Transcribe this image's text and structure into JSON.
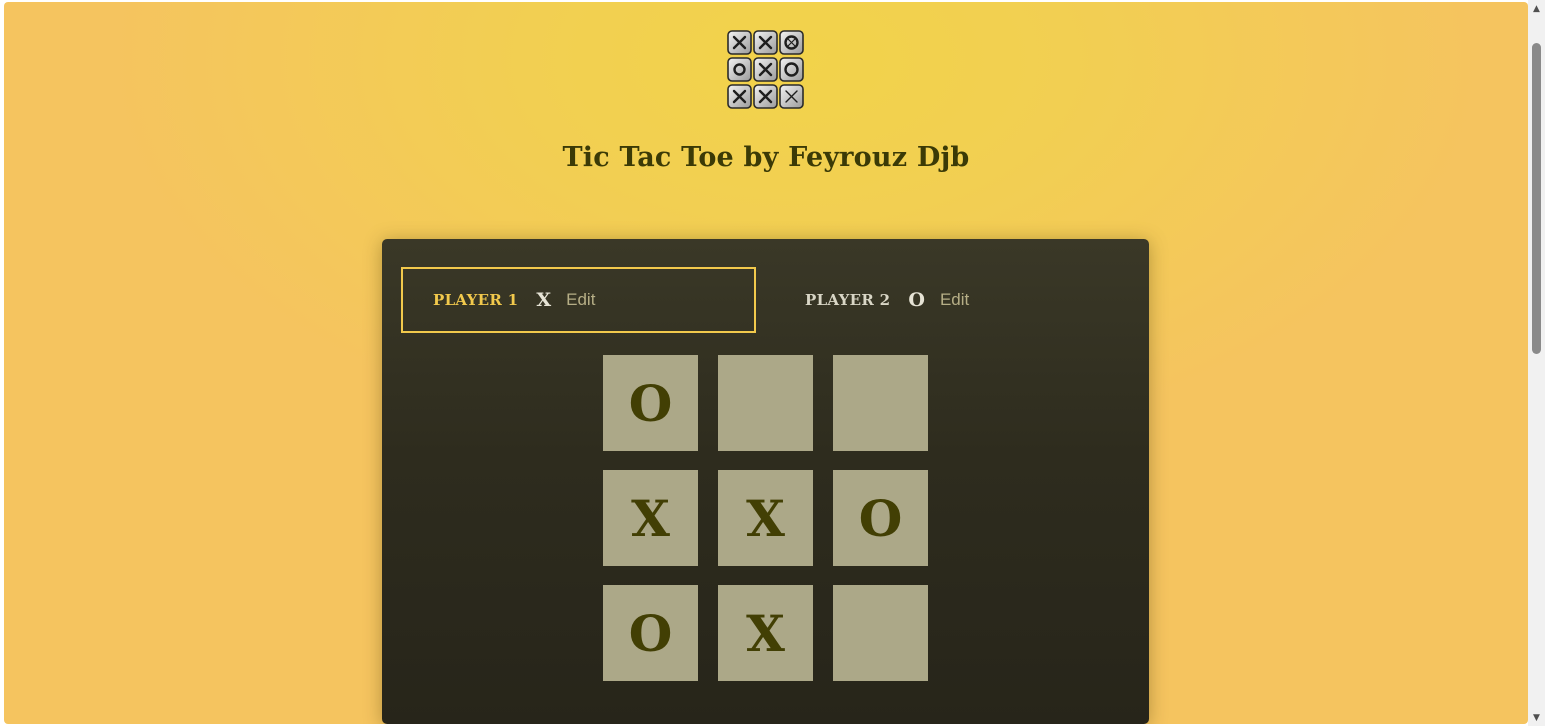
{
  "header": {
    "title": "Tic Tac Toe by Feyrouz Djb",
    "logo_icon": "tic-tac-toe-logo-icon"
  },
  "players": [
    {
      "name": "PLAYER 1",
      "symbol": "X",
      "edit_label": "Edit",
      "active": true
    },
    {
      "name": "PLAYER 2",
      "symbol": "O",
      "edit_label": "Edit",
      "active": false
    }
  ],
  "board": {
    "rows": [
      [
        "O",
        "",
        ""
      ],
      [
        "X",
        "X",
        "O"
      ],
      [
        "O",
        "X",
        ""
      ]
    ]
  },
  "colors": {
    "accent": "#f2c94c",
    "panel": "#2f2d20",
    "cell": "#aca888",
    "mark": "#423f04",
    "background": "#f2cf52"
  },
  "scrollbar": {
    "up_icon": "scroll-up-arrow-icon",
    "down_icon": "scroll-down-arrow-icon"
  }
}
